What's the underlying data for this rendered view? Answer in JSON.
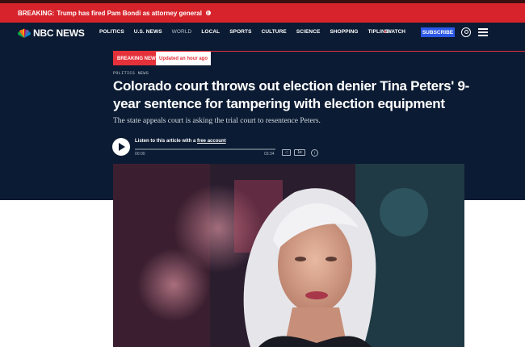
{
  "breaking_bar": {
    "label": "BREAKING:",
    "text": "Trump has fired Pam Bondi as attorney general"
  },
  "nav": {
    "logo": "NBC NEWS",
    "links": [
      "POLITICS",
      "U.S. NEWS",
      "WORLD",
      "LOCAL",
      "SPORTS",
      "CULTURE",
      "SCIENCE",
      "SHOPPING",
      "TIPLINE"
    ],
    "watch": "WATCH",
    "subscribe": "SUBSCRIBE"
  },
  "article": {
    "badge_breaking": "BREAKING NEWS",
    "badge_updated": "Updated an hour ago",
    "kicker": "POLITICS NEWS",
    "headline": "Colorado court throws out election denier Tina Peters' 9-year sentence for tampering with election equipment",
    "dek": "The state appeals court is asking the trial court to resentence Peters."
  },
  "audio": {
    "listen_prefix": "Listen to this article with a ",
    "listen_link": "free account",
    "time_start": "00:00",
    "time_end": "03:34",
    "speed": "1x",
    "progress": 0
  },
  "colors": {
    "nav_bg": "#0b1b33",
    "breaking_red": "#d7242c",
    "subscribe_blue": "#2c59e6"
  }
}
